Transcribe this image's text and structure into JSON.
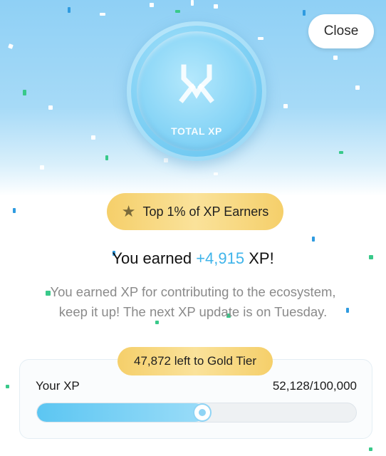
{
  "close_label": "Close",
  "coin": {
    "brand_text": "TOTAL XP",
    "logo_icon": "total-xp-logo-icon"
  },
  "badge": {
    "icon": "star-icon",
    "label": "Top 1% of XP Earners"
  },
  "earned": {
    "prefix": "You earned",
    "amount": "+4,915",
    "suffix": "XP!"
  },
  "description": {
    "line1": "You earned XP for contributing to the ecosystem,",
    "line2": "keep it up! The next XP update is on Tuesday."
  },
  "progress": {
    "tier_label": "47,872 left to Gold Tier",
    "label": "Your XP",
    "value_text": "52,128/100,000",
    "current": 52128,
    "max": 100000
  },
  "colors": {
    "accent": "#3fb4ea",
    "gold": "#f5cf6a"
  }
}
